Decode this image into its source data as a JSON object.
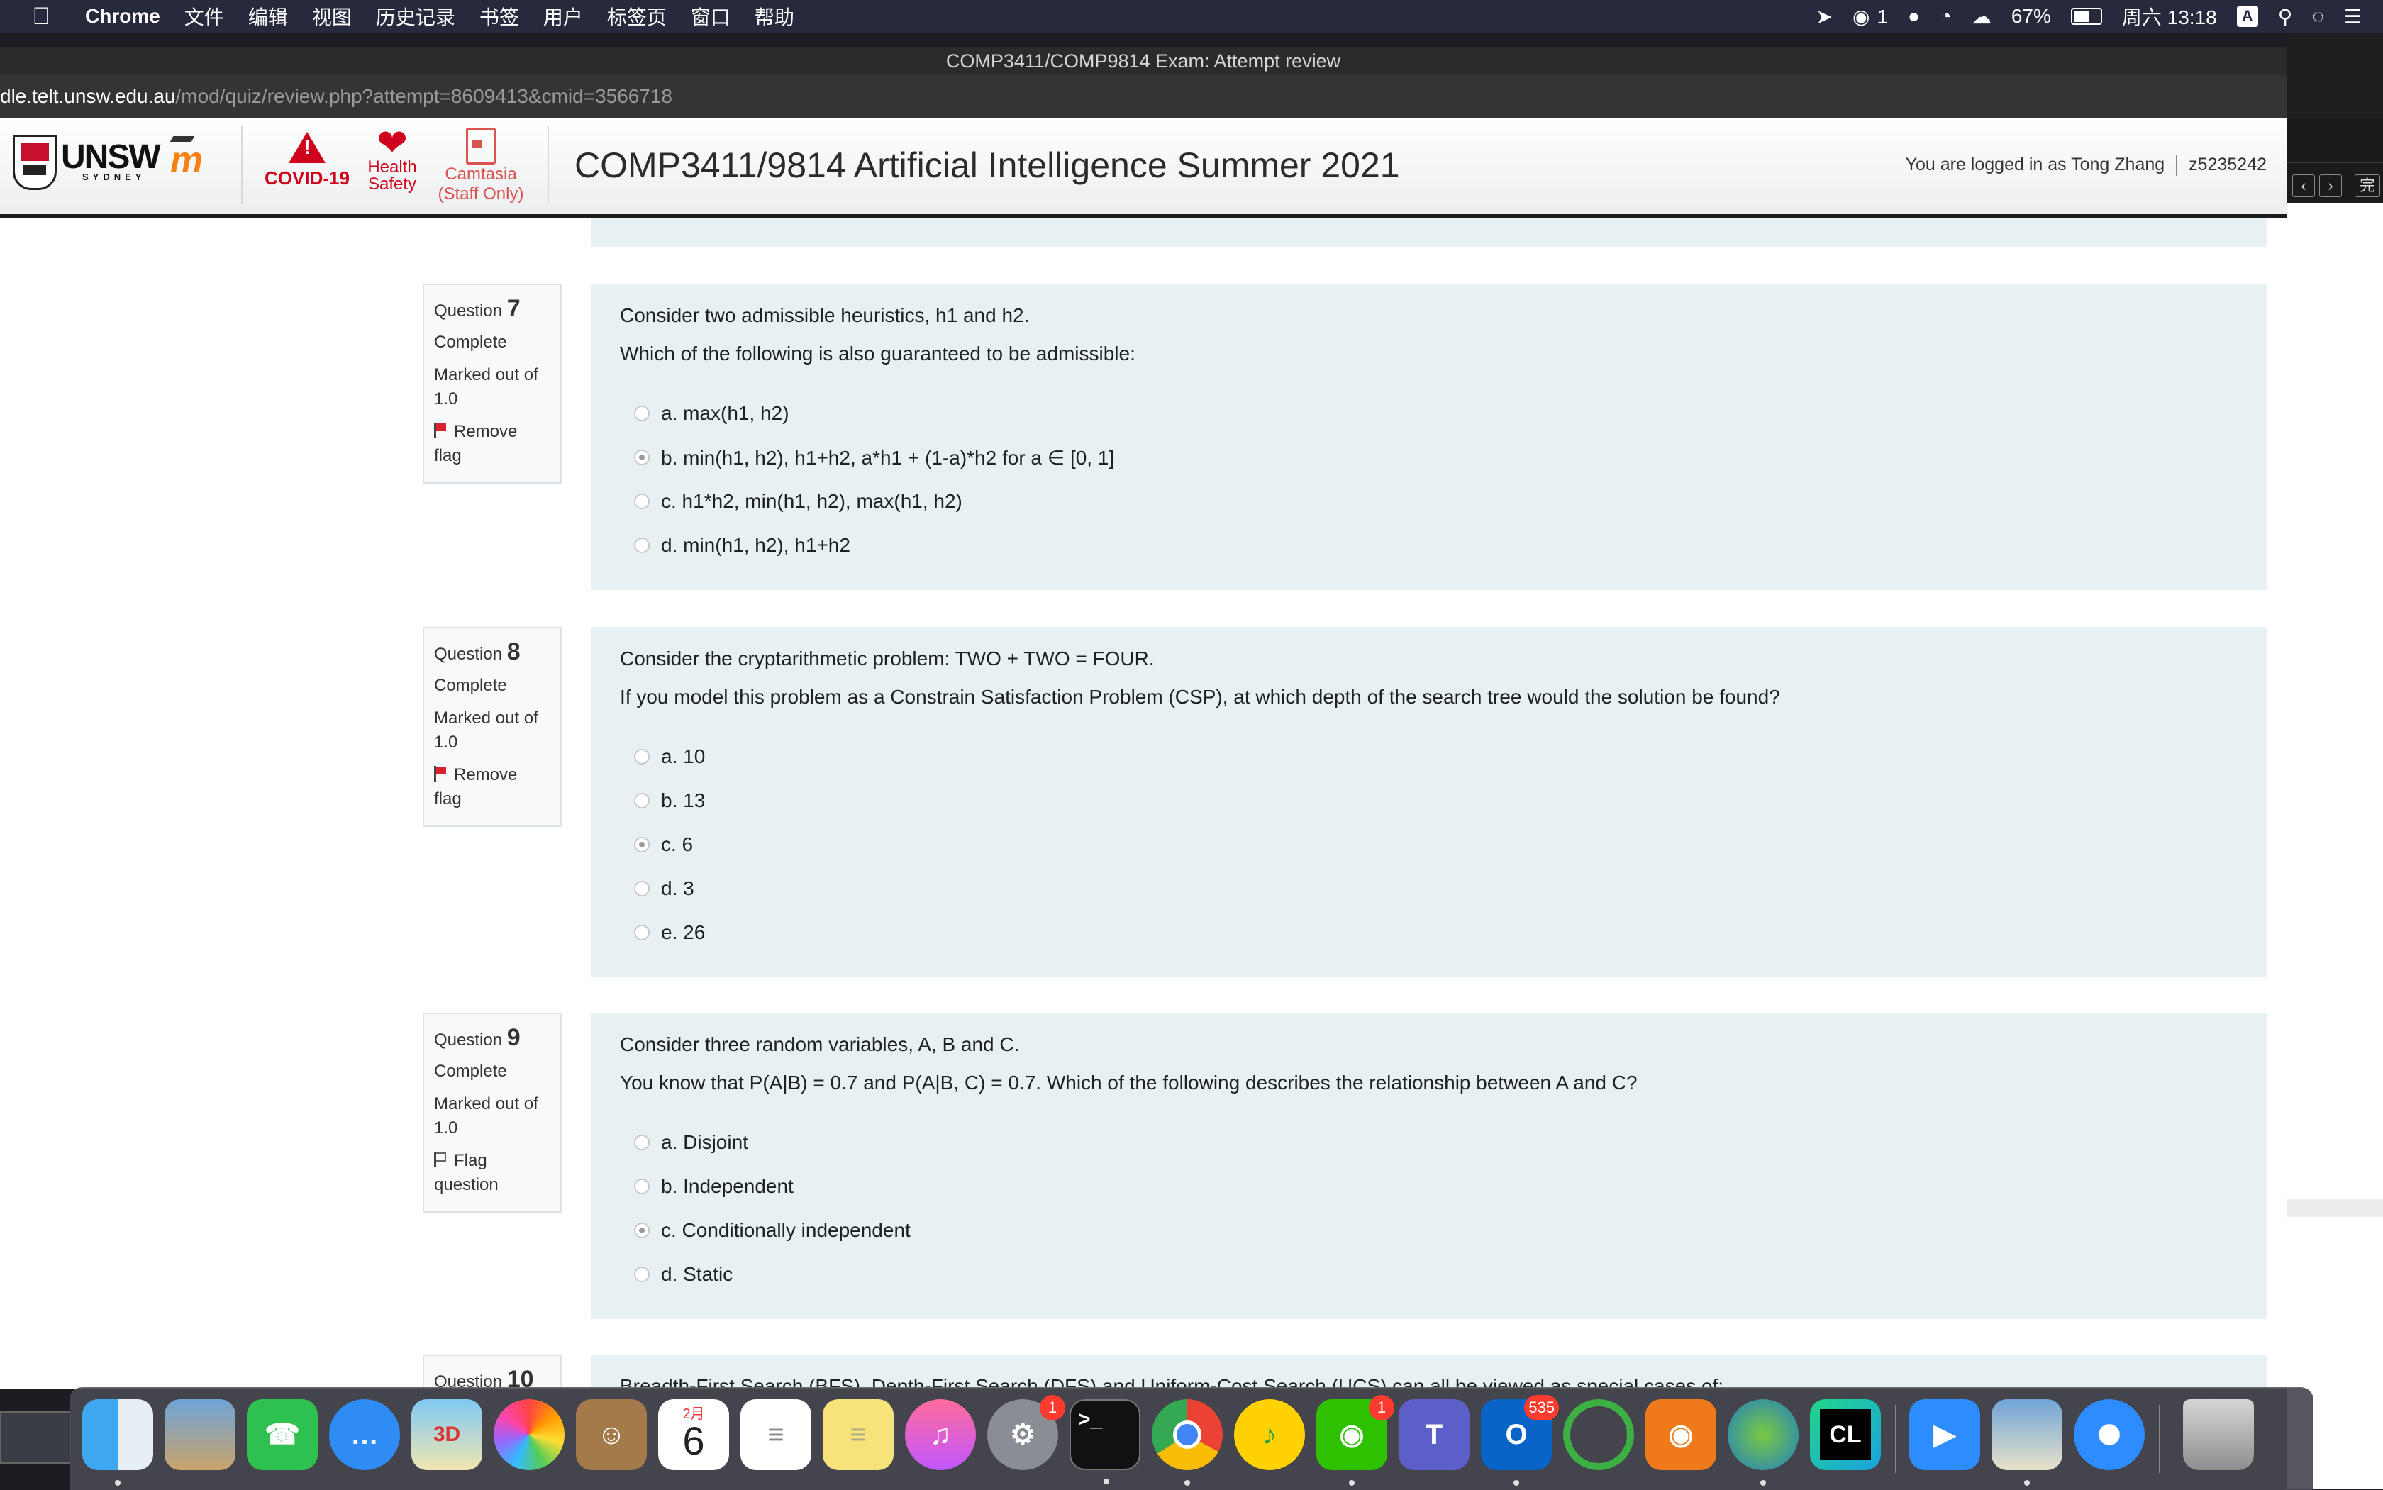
{
  "menubar": {
    "app": "Chrome",
    "items": [
      "文件",
      "编辑",
      "视图",
      "历史记录",
      "书签",
      "用户",
      "标签页",
      "窗口",
      "帮助"
    ],
    "status": {
      "wechat_count": "1",
      "battery": "67%",
      "battery_level": 0.67,
      "clock": "周六 13:18",
      "input_method": "A"
    }
  },
  "window": {
    "title": "COMP3411/COMP9814 Exam: Attempt review",
    "url_host": "dle.telt.unsw.edu.au",
    "url_path": "/mod/quiz/review.php?attempt=8609413&cmid=3566718"
  },
  "header": {
    "logo_text": "UNSW",
    "logo_sub": "SYDNEY",
    "covid_label": "COVID-19",
    "health_line1": "Health",
    "health_line2": "Safety",
    "camtasia_line1": "Camtasia",
    "camtasia_line2": "(Staff Only)",
    "course_title": "COMP3411/9814 Artificial Intelligence Summer 2021",
    "logged_in": "You are logged in as Tong Zhang",
    "user_id": "z5235242"
  },
  "questions": [
    {
      "label": "Question",
      "number": "7",
      "state": "Complete",
      "grade_line1": "Marked out of",
      "grade_line2": "1.0",
      "flag_line1": "Remove",
      "flag_line2": "flag",
      "flagged": true,
      "text": [
        "Consider two admissible heuristics, h1 and h2.",
        "Which of the following is also guaranteed to be admissible:"
      ],
      "options": [
        {
          "label": "a. max(h1, h2)",
          "selected": false
        },
        {
          "label": "b. min(h1, h2), h1+h2, a*h1 + (1-a)*h2 for a ∈ [0, 1]",
          "selected": true
        },
        {
          "label": "c. h1*h2, min(h1, h2), max(h1, h2)",
          "selected": false
        },
        {
          "label": "d. min(h1, h2), h1+h2",
          "selected": false
        }
      ]
    },
    {
      "label": "Question",
      "number": "8",
      "state": "Complete",
      "grade_line1": "Marked out of",
      "grade_line2": "1.0",
      "flag_line1": "Remove",
      "flag_line2": "flag",
      "flagged": true,
      "text": [
        "Consider the cryptarithmetic problem: TWO + TWO = FOUR.",
        "If you model this problem as a Constrain Satisfaction Problem (CSP), at which depth of the search tree would the solution be found?"
      ],
      "options": [
        {
          "label": "a. 10",
          "selected": false
        },
        {
          "label": "b. 13",
          "selected": false
        },
        {
          "label": "c. 6",
          "selected": true
        },
        {
          "label": "d. 3",
          "selected": false
        },
        {
          "label": "e. 26",
          "selected": false
        }
      ]
    },
    {
      "label": "Question",
      "number": "9",
      "state": "Complete",
      "grade_line1": "Marked out of",
      "grade_line2": "1.0",
      "flag_line1": "Flag",
      "flag_line2": "question",
      "flagged": false,
      "text": [
        "Consider three random variables, A, B and C.",
        "You know that P(A|B) = 0.7 and P(A|B, C) = 0.7. Which of the following describes the relationship between A and C?"
      ],
      "options": [
        {
          "label": "a. Disjoint",
          "selected": false
        },
        {
          "label": "b. Independent",
          "selected": false
        },
        {
          "label": "c. Conditionally independent",
          "selected": true
        },
        {
          "label": "d. Static",
          "selected": false
        }
      ]
    },
    {
      "label": "Question",
      "number": "10",
      "text": [
        "Breadth-First Search (BFS), Depth-First Search (DFS) and Uniform-Cost Search (UCS) can all be viewed as special cases of:"
      ]
    }
  ],
  "dock": {
    "calendar_month": "2月",
    "calendar_day": "6",
    "sys_pref_badge": "1",
    "wechat_badge": "1",
    "outlook_badge": "535",
    "teams_letter": "T",
    "outlook_letter": "O",
    "clion_letters": "CL",
    "terminal_prompt": ">_"
  }
}
